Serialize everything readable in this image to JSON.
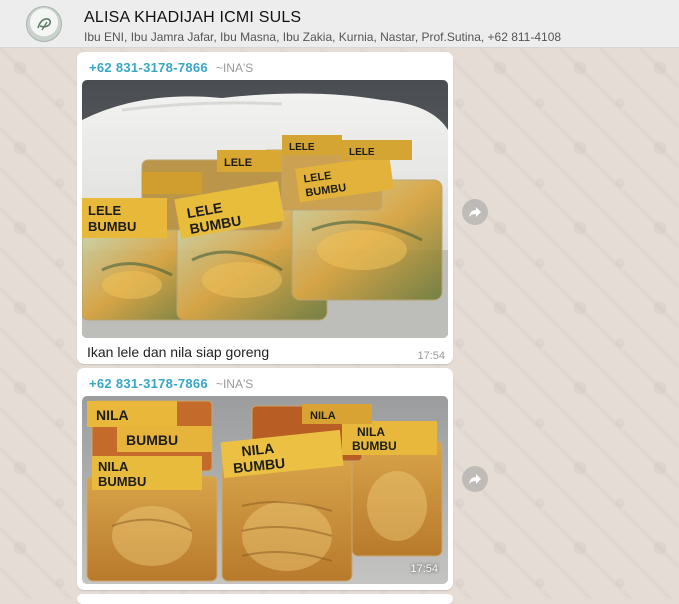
{
  "header": {
    "title": "ALISA KHADIJAH ICMI SULS",
    "members": "Ibu ENI, Ibu Jamra Jafar, Ibu Masna, Ibu Zakia, Kurnia, Nastar, Prof.Sutina, +62 811-4108",
    "avatar_icon": "group-logo-icon"
  },
  "messages": [
    {
      "sender_phone": "+62 831-3178-7866",
      "sender_alias": "~INA'S",
      "caption": "Ikan lele dan nila siap goreng",
      "time": "17:54",
      "packages": [
        "LELE BUMBU",
        "LELE BUMBU",
        "LELE BUMBU",
        "LELE",
        "LELE",
        "LELE"
      ]
    },
    {
      "sender_phone": "+62 831-3178-7866",
      "sender_alias": "~INA'S",
      "time": "17:54",
      "packages": [
        "NILA BUMBU",
        "NILA BUMBU",
        "NILA BUMBU",
        "NILA",
        "NILA"
      ]
    }
  ],
  "icons": {
    "forward": "forward-arrow-icon"
  },
  "colors": {
    "sender": "#35a7c5",
    "bubble": "#ffffff",
    "wallpaper": "#e5ddd5"
  }
}
